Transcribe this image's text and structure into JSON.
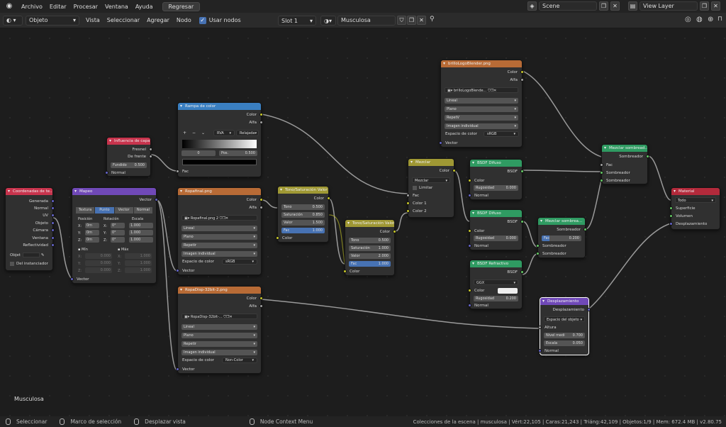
{
  "menu": {
    "items": [
      "Archivo",
      "Editar",
      "Procesar",
      "Ventana",
      "Ayuda"
    ],
    "regresar": "Regresar"
  },
  "scene": {
    "label": "Scene",
    "view_layer": "View Layer"
  },
  "header": {
    "mode": "Objeto",
    "menu": [
      "Vista",
      "Seleccionar",
      "Agregar",
      "Nodo"
    ],
    "use_nodes": "Usar nodos",
    "slot": "Slot 1",
    "material": "Musculosa"
  },
  "canvas": {
    "label": "Musculosa"
  },
  "nodes": {
    "coords": {
      "title": "Coordenadas de te...",
      "outputs": [
        "Generada",
        "Normal",
        "UV",
        "Objeto",
        "Cámara",
        "Ventana",
        "Reflectividad"
      ],
      "object_label": "Objet",
      "from_instancer": "Del instanciador"
    },
    "mapping": {
      "title": "Mapeo",
      "vector": "Vector",
      "types": [
        "Textura",
        "Punto",
        "Vector",
        "Normal"
      ],
      "pos": "Posición",
      "rot": "Rotación",
      "scale": "Escala",
      "rows": [
        [
          "X:",
          "0m",
          "X:",
          "0°",
          "1.000"
        ],
        [
          "Y:",
          "0m",
          "Y:",
          "0°",
          "1.000"
        ],
        [
          "Z:",
          "0m",
          "Z:",
          "0°",
          "1.000"
        ]
      ],
      "min": "Mín",
      "max": "Máx",
      "minmax": [
        [
          "X:",
          "0.000",
          "X:",
          "1.000"
        ],
        [
          "Y:",
          "0.000",
          "Y:",
          "1.000"
        ],
        [
          "Z:",
          "0.000",
          "Z:",
          "1.000"
        ]
      ],
      "vector_in": "Vector"
    },
    "layer": {
      "title": "Influencia de capa",
      "outputs": [
        "Fresnel",
        "De frente"
      ],
      "blend": "Fundido",
      "blend_val": "0.500",
      "normal": "Normal"
    },
    "ramp": {
      "title": "Rampa de color",
      "outputs": [
        "Color",
        "Alfa"
      ],
      "mode": "RVA",
      "interp": "Relajada",
      "idx": "0",
      "pos": "Pos.",
      "pos_val": "0.500",
      "fac": "Fac"
    },
    "ropa": {
      "title": "Ropafinal.png",
      "outputs": [
        "Color",
        "Alfa"
      ],
      "file": "Ropafinal.png",
      "users": "2",
      "opts": [
        "Lineal",
        "Plano",
        "Repetir",
        "Imagen individual"
      ],
      "cs": "Espacio de color",
      "cs_val": "sRGB",
      "vector": "Vector"
    },
    "disp_tex": {
      "title": "RopaDisp-32bit-2.png",
      "outputs": [
        "Color",
        "Alfa"
      ],
      "file": "RopaDisp-32bit-...",
      "opts": [
        "Lineal",
        "Plano",
        "Repetir",
        "Imagen individual"
      ],
      "cs": "Espacio de color",
      "cs_val": "Non-Color",
      "vector": "Vector"
    },
    "hsv1": {
      "title": "Tono/Saturación Valor",
      "out": "Color",
      "rows": [
        [
          "Tono",
          "0.500"
        ],
        [
          "Saturación",
          "0.850"
        ],
        [
          "Valor",
          "1.500"
        ],
        [
          "Fac",
          "1.000"
        ]
      ],
      "color": "Color"
    },
    "hsv2": {
      "title": "Tono/Saturación Valor",
      "out": "Color",
      "rows": [
        [
          "Tono",
          "0.500"
        ],
        [
          "Saturación",
          "1.000"
        ],
        [
          "Valor",
          "2.000"
        ],
        [
          "Fac",
          "1.000"
        ]
      ],
      "color": "Color"
    },
    "mix": {
      "title": "Mezclar",
      "out": "Color",
      "mode": "Mezclar",
      "clamp": "Limitar",
      "inputs": [
        "Fac",
        "Color 1",
        "Color 2"
      ]
    },
    "brillo": {
      "title": "brilloLogoBlender.png",
      "outputs": [
        "Color",
        "Alfa"
      ],
      "file": "brilloLogoBlende...",
      "opts": [
        "Lineal",
        "Plano",
        "RepetV",
        "Imagen individual"
      ],
      "cs": "Espacio de color",
      "cs_val": "sRGB",
      "vector": "Vector"
    },
    "diffuse1": {
      "title": "BSDF Difuso",
      "out": "BSDF",
      "color": "Color",
      "rough": "Rugosidad",
      "rough_val": "0.000",
      "normal": "Normal"
    },
    "diffuse2": {
      "title": "BSDF Difuso",
      "out": "BSDF",
      "color": "Color",
      "rough": "Rugosidad",
      "rough_val": "0.000",
      "normal": "Normal"
    },
    "refractive": {
      "title": "BSDF Refractivo",
      "dist": "GGX",
      "color": "Color",
      "rough": "Rugosidad",
      "rough_val": "0.200",
      "normal": "Normal"
    },
    "mixsh1": {
      "title": "Mezclar sombread...",
      "out": "Sombreador",
      "inputs": [
        "Fac",
        "Sombreador",
        "Sombreador"
      ]
    },
    "mixsh2": {
      "title": "Mezclar sombrea...",
      "out": "Sombreador",
      "fac": "Fac",
      "fac_val": "0.200",
      "inputs": [
        "Sombreador",
        "Sombreador"
      ]
    },
    "displace": {
      "title": "Desplazamiento",
      "out": "Desplazamiento",
      "space": "Espacio del objeto",
      "height": "Altura",
      "mid": "Nivel medi",
      "mid_val": "0.700",
      "scale": "Escala",
      "scale_val": "0.050",
      "normal": "Normal"
    },
    "output": {
      "title": "Material",
      "target": "Todo",
      "inputs": [
        "Superficie",
        "Volumen",
        "Desplazamiento"
      ]
    }
  },
  "status": {
    "select": "Seleccionar",
    "box": "Marco de selección",
    "pan": "Desplazar vista",
    "ctx": "Node Context Menu",
    "info": "Colecciones de la escena | musculosa | Vért:22,105 | Caras:21,243 | Triáng:42,109 | Objetos:1/9 | Mem: 672.4 MB | v2.80.75"
  }
}
